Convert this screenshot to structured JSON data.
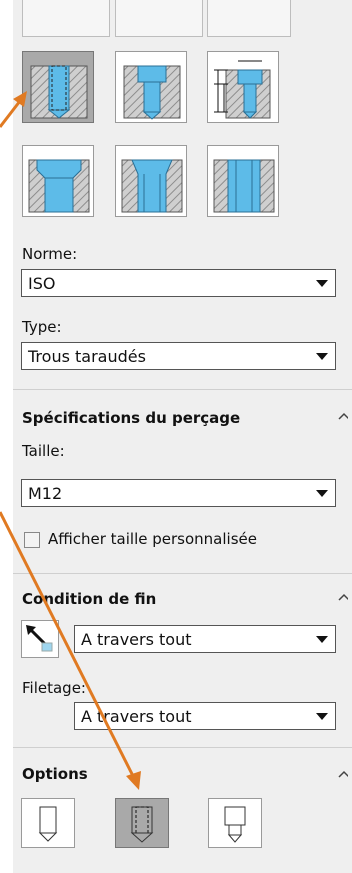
{
  "standard": {
    "label": "Norme:",
    "value": "ISO"
  },
  "type": {
    "label": "Type:",
    "value": "Trous taraudés"
  },
  "hole_spec": {
    "title": "Spécifications du perçage",
    "size_label": "Taille:",
    "size_value": "M12",
    "custom_size_label": "Afficher taille personnalisée"
  },
  "end_condition": {
    "title": "Condition de fin",
    "value": "A travers tout",
    "thread_label": "Filetage:",
    "thread_value": "A travers tout"
  },
  "options": {
    "title": "Options"
  },
  "icons": {
    "hole_types": [
      "counterbore-hole-icon",
      "countersink-hole-icon",
      "slot-hole-icon",
      "straight-tap-icon",
      "tapered-tap-icon",
      "legacy-hole-icon"
    ],
    "arrow_color": "#e07a22",
    "hole_blue": "#4fb6e6"
  }
}
